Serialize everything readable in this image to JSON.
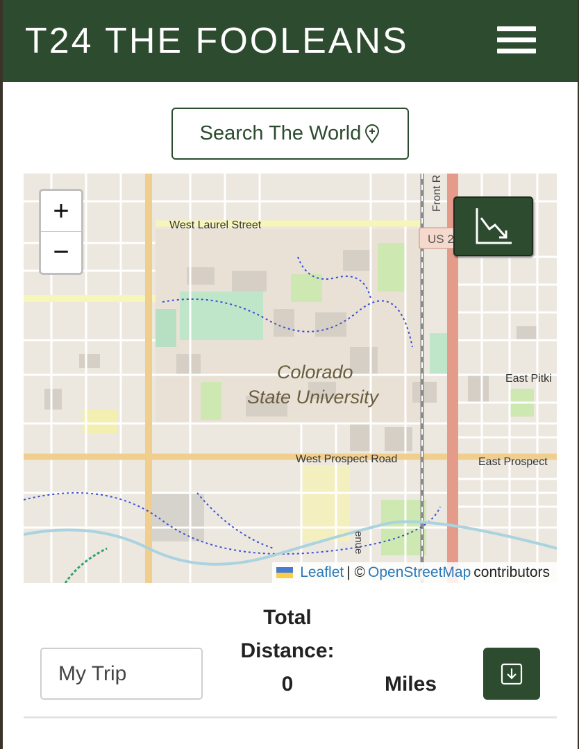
{
  "app": {
    "title": "T24 THE FOOLEANS"
  },
  "header": {
    "menu_icon": "hamburger-menu-icon"
  },
  "search": {
    "label": "Search The World",
    "icon": "map-pin-plus-icon"
  },
  "map": {
    "zoom_in": "+",
    "zoom_out": "−",
    "chart_icon": "trending-down-chart-icon",
    "labels": {
      "laurel": "West Laurel Street",
      "us": "US 2",
      "front": "Front R",
      "csu_line1": "Colorado",
      "csu_line2": "State University",
      "pitkin": "East Pitki",
      "prospect_w": "West Prospect Road",
      "prospect_e": "East Prospect",
      "avenue": "enue"
    },
    "attribution": {
      "leaflet": "Leaflet",
      "sep": "| ©",
      "osm": "OpenStreetMap",
      "contributors": "contributors"
    }
  },
  "trip": {
    "name_placeholder": "My Trip",
    "distance_label": "Total Distance:",
    "distance_value": "0",
    "units": "Miles",
    "save_icon": "download-icon"
  },
  "colors": {
    "brand": "#2d4b2e",
    "link": "#2a7ab8"
  }
}
